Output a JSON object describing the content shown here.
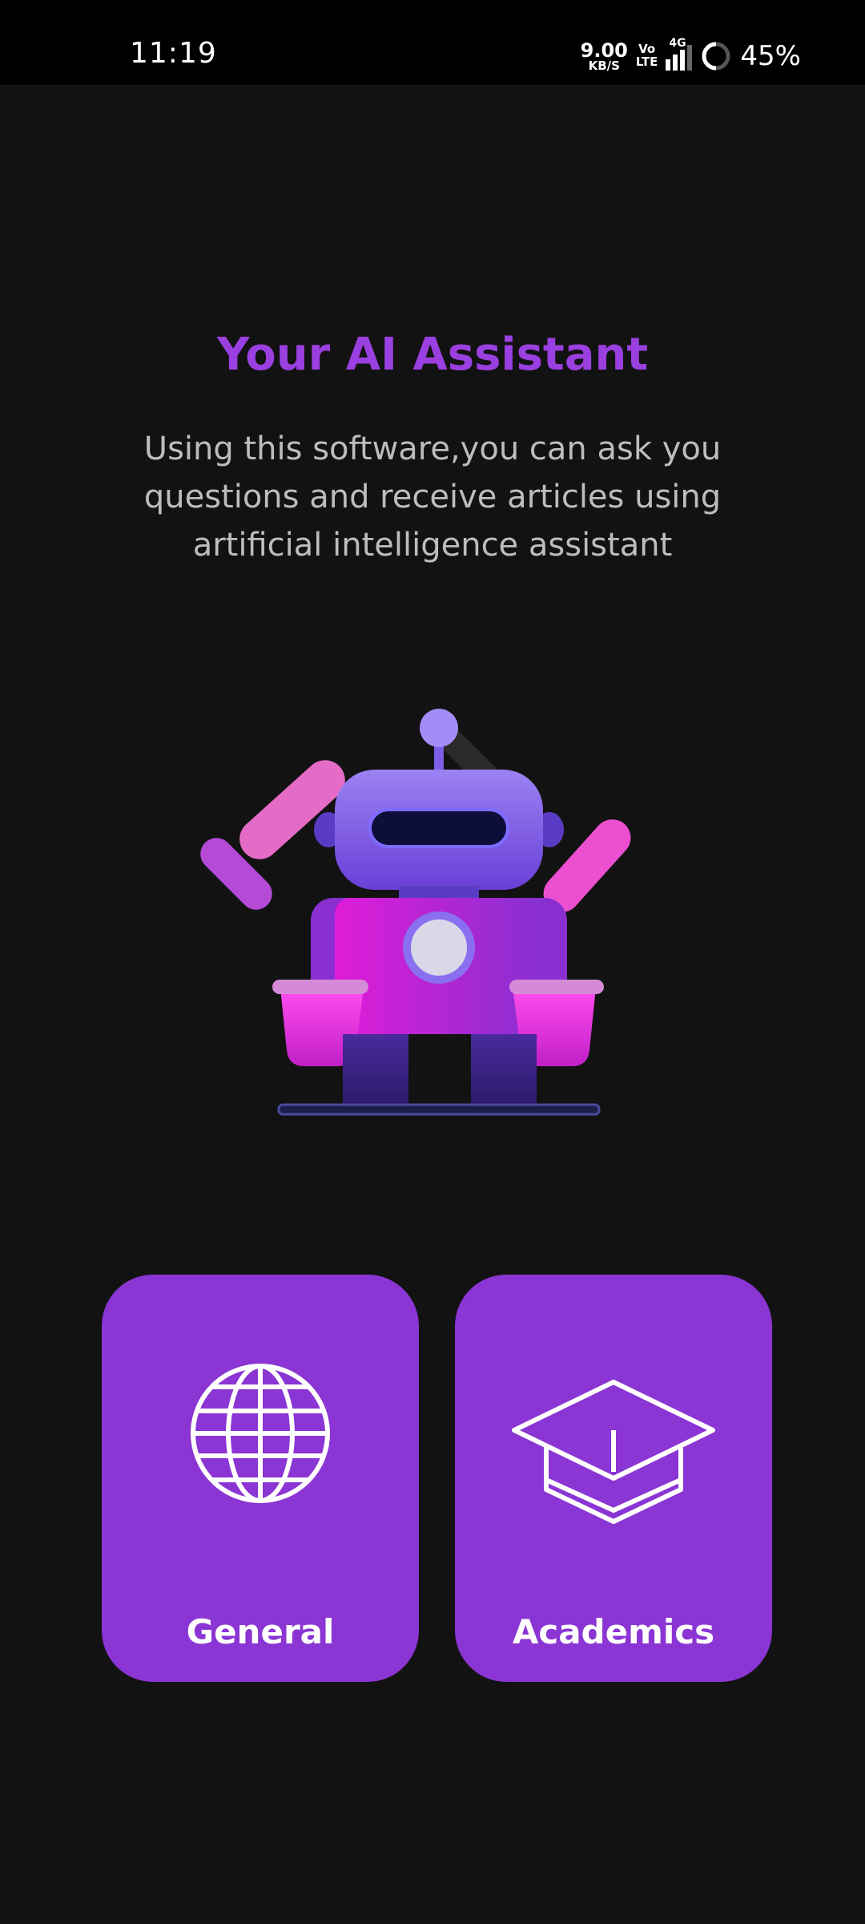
{
  "status_bar": {
    "time": "11:19",
    "net_speed_value": "9.00",
    "net_speed_unit": "KB/S",
    "volte_top": "Vo",
    "volte_bottom": "LTE",
    "network": "4G",
    "battery_percent": "45%"
  },
  "hero": {
    "title": "Your AI Assistant",
    "description": "Using this software,you can ask you questions and receive articles using artificial intelligence assistant"
  },
  "illustration": {
    "icon": "robot-illustration"
  },
  "categories": [
    {
      "label": "General",
      "icon": "globe-icon"
    },
    {
      "label": "Academics",
      "icon": "graduation-cap-icon"
    }
  ],
  "colors": {
    "background": "#121212",
    "accent": "#8a35d4",
    "title": "#9a3fe0",
    "text_secondary": "#bdbdbd"
  }
}
